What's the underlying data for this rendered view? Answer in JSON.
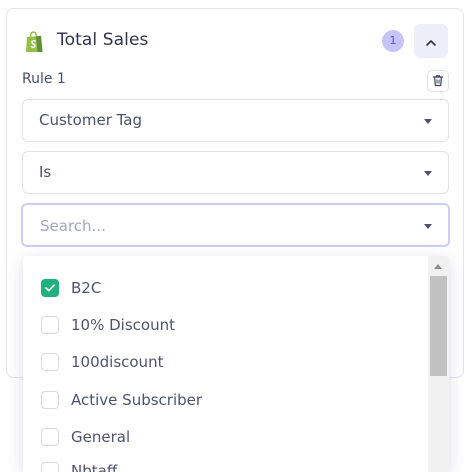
{
  "header": {
    "title": "Total Sales",
    "badge_count": "1",
    "logo_icon": "shopify-bag-icon",
    "collapse_icon": "chevron-up-icon"
  },
  "rule": {
    "label": "Rule 1",
    "delete_icon": "trash-icon"
  },
  "filters": {
    "field_value": "Customer Tag",
    "operator_value": "Is"
  },
  "search": {
    "placeholder": "Search..."
  },
  "options": [
    {
      "label": "B2C",
      "checked": true
    },
    {
      "label": "10% Discount",
      "checked": false
    },
    {
      "label": "100discount",
      "checked": false
    },
    {
      "label": "Active Subscriber",
      "checked": false
    },
    {
      "label": "General",
      "checked": false
    },
    {
      "label": "Nbtaff",
      "checked": false
    }
  ],
  "colors": {
    "accent": "#22b07d",
    "badge_bg": "#c6c3f7",
    "focus_border": "#cfcdf6"
  }
}
